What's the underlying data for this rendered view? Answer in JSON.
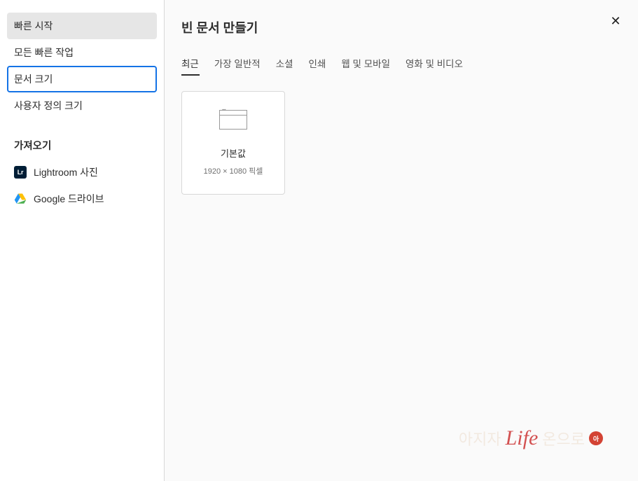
{
  "sidebar": {
    "items": [
      {
        "label": "빠른 시작",
        "state": "highlighted"
      },
      {
        "label": "모든 빠른 작업",
        "state": ""
      },
      {
        "label": "문서 크기",
        "state": "selected"
      },
      {
        "label": "사용자 정의 크기",
        "state": ""
      }
    ],
    "import_title": "가져오기",
    "import_items": [
      {
        "label": "Lightroom 사진",
        "icon": "lightroom"
      },
      {
        "label": "Google 드라이브",
        "icon": "gdrive"
      }
    ]
  },
  "main": {
    "title": "빈 문서 만들기",
    "tabs": [
      {
        "label": "최근",
        "active": true
      },
      {
        "label": "가장 일반적",
        "active": false
      },
      {
        "label": "소셜",
        "active": false
      },
      {
        "label": "인쇄",
        "active": false
      },
      {
        "label": "웹 및 모바일",
        "active": false
      },
      {
        "label": "영화 및 비디오",
        "active": false
      }
    ],
    "presets": [
      {
        "name": "기본값",
        "dims": "1920 × 1080 픽셀"
      }
    ]
  },
  "watermark": {
    "text": "Life"
  }
}
